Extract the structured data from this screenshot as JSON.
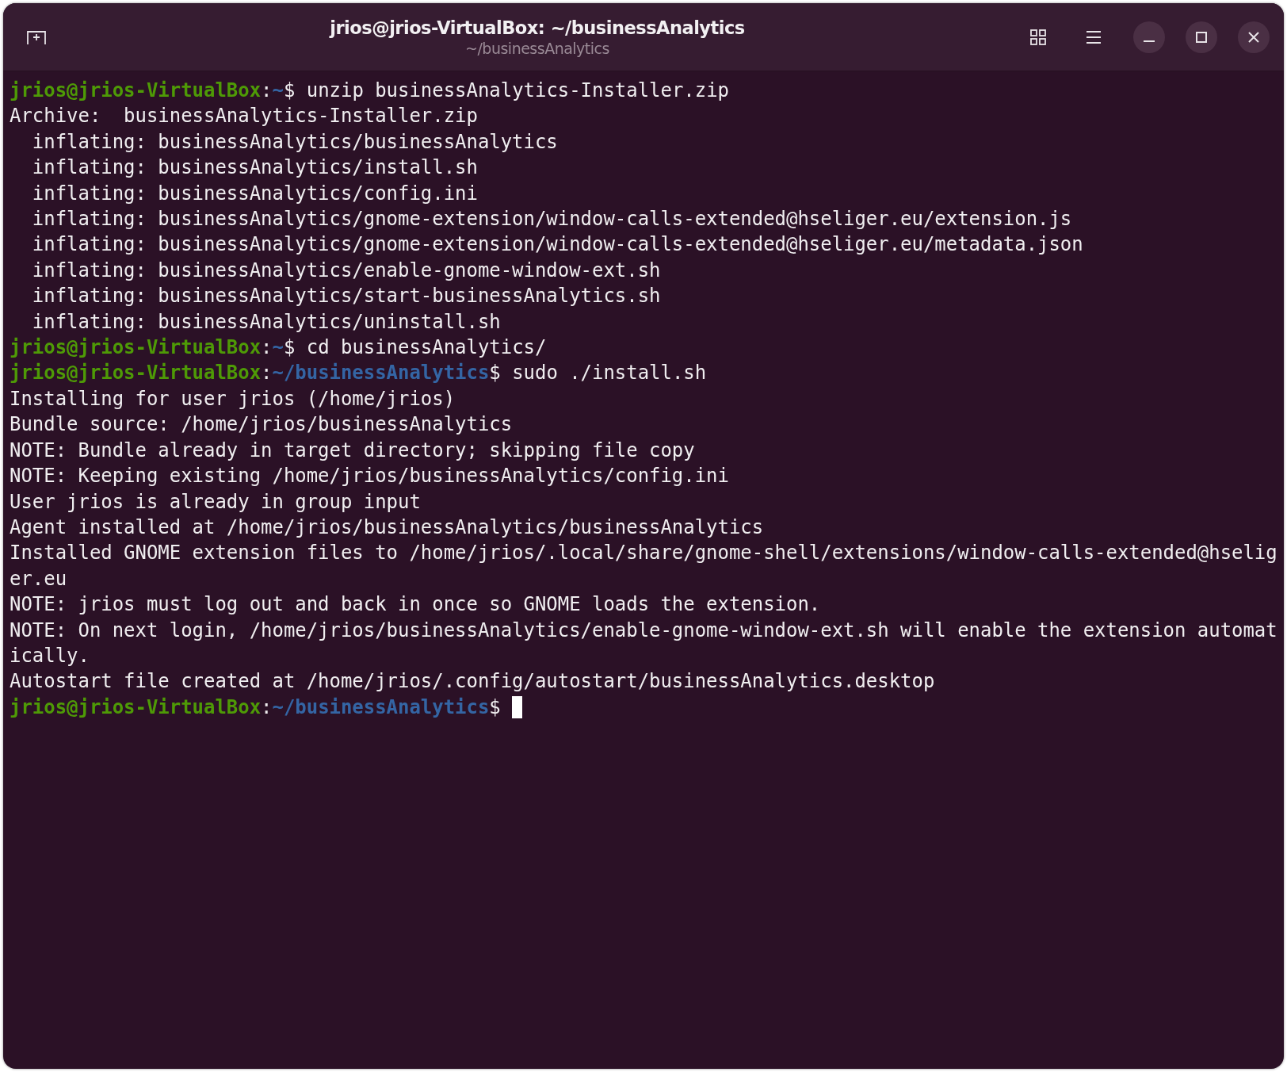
{
  "window": {
    "title": "jrios@jrios-VirtualBox: ~/businessAnalytics",
    "subtitle": "~/businessAnalytics"
  },
  "terminal": {
    "lines": [
      {
        "kind": "prompt",
        "user": "jrios@jrios-VirtualBox",
        "sep": ":",
        "path": "~",
        "dollar": "$ ",
        "command": "unzip businessAnalytics-Installer.zip"
      },
      {
        "kind": "output",
        "text": "Archive:  businessAnalytics-Installer.zip"
      },
      {
        "kind": "output",
        "text": "  inflating: businessAnalytics/businessAnalytics"
      },
      {
        "kind": "output",
        "text": "  inflating: businessAnalytics/install.sh"
      },
      {
        "kind": "output",
        "text": "  inflating: businessAnalytics/config.ini"
      },
      {
        "kind": "output",
        "text": "  inflating: businessAnalytics/gnome-extension/window-calls-extended@hseliger.eu/extension.js"
      },
      {
        "kind": "output",
        "text": "  inflating: businessAnalytics/gnome-extension/window-calls-extended@hseliger.eu/metadata.json"
      },
      {
        "kind": "output",
        "text": "  inflating: businessAnalytics/enable-gnome-window-ext.sh"
      },
      {
        "kind": "output",
        "text": "  inflating: businessAnalytics/start-businessAnalytics.sh"
      },
      {
        "kind": "output",
        "text": "  inflating: businessAnalytics/uninstall.sh"
      },
      {
        "kind": "prompt",
        "user": "jrios@jrios-VirtualBox",
        "sep": ":",
        "path": "~",
        "dollar": "$ ",
        "command": "cd businessAnalytics/"
      },
      {
        "kind": "prompt",
        "user": "jrios@jrios-VirtualBox",
        "sep": ":",
        "path": "~/businessAnalytics",
        "dollar": "$ ",
        "command": "sudo ./install.sh"
      },
      {
        "kind": "output",
        "text": "Installing for user jrios (/home/jrios)"
      },
      {
        "kind": "output",
        "text": "Bundle source: /home/jrios/businessAnalytics"
      },
      {
        "kind": "output",
        "text": "NOTE: Bundle already in target directory; skipping file copy"
      },
      {
        "kind": "output",
        "text": "NOTE: Keeping existing /home/jrios/businessAnalytics/config.ini"
      },
      {
        "kind": "output",
        "text": "User jrios is already in group input"
      },
      {
        "kind": "output",
        "text": "Agent installed at /home/jrios/businessAnalytics/businessAnalytics"
      },
      {
        "kind": "output",
        "text": "Installed GNOME extension files to /home/jrios/.local/share/gnome-shell/extensions/window-calls-extended@hselig"
      },
      {
        "kind": "output",
        "text": "er.eu"
      },
      {
        "kind": "output",
        "text": "NOTE: jrios must log out and back in once so GNOME loads the extension."
      },
      {
        "kind": "output",
        "text": "NOTE: On next login, /home/jrios/businessAnalytics/enable-gnome-window-ext.sh will enable the extension automat"
      },
      {
        "kind": "output",
        "text": "ically."
      },
      {
        "kind": "output",
        "text": "Autostart file created at /home/jrios/.config/autostart/businessAnalytics.desktop"
      },
      {
        "kind": "prompt",
        "user": "jrios@jrios-VirtualBox",
        "sep": ":",
        "path": "~/businessAnalytics",
        "dollar": "$ ",
        "cursor": true
      }
    ]
  }
}
